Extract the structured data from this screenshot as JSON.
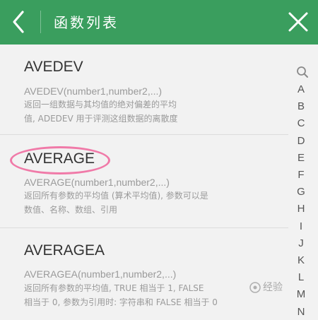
{
  "header": {
    "title": "函数列表",
    "background": "#3a9e5e"
  },
  "functions": [
    {
      "name": "AVEDEV",
      "syntax": "AVEDEV(number1,number2,...)",
      "desc_line1": "返回一组数据与其均值的绝对偏差的平均",
      "desc_line2": "值, ADEDEV 用于评测这组数据的离散度"
    },
    {
      "name": "AVERAGE",
      "syntax": "AVERAGE(number1,number2,...)",
      "desc_line1": "返回所有参数的平均值 (算术平均值), 参数可以是",
      "desc_line2": "数值、名称、数组、引用"
    },
    {
      "name": "AVERAGEA",
      "syntax": "AVERAGEA(number1,number2,...)",
      "desc_line1": "返回所有参数的平均值, TRUE 相当于 1, FALSE",
      "desc_line2": "相当于 0, 参数为引用时: 字符串和 FALSE 相当于 0"
    }
  ],
  "index": {
    "search_icon": "search-icon",
    "letters": [
      "A",
      "B",
      "C",
      "D",
      "E",
      "F",
      "G",
      "H",
      "I",
      "J",
      "K",
      "L",
      "M",
      "N"
    ]
  },
  "watermark": "经验"
}
